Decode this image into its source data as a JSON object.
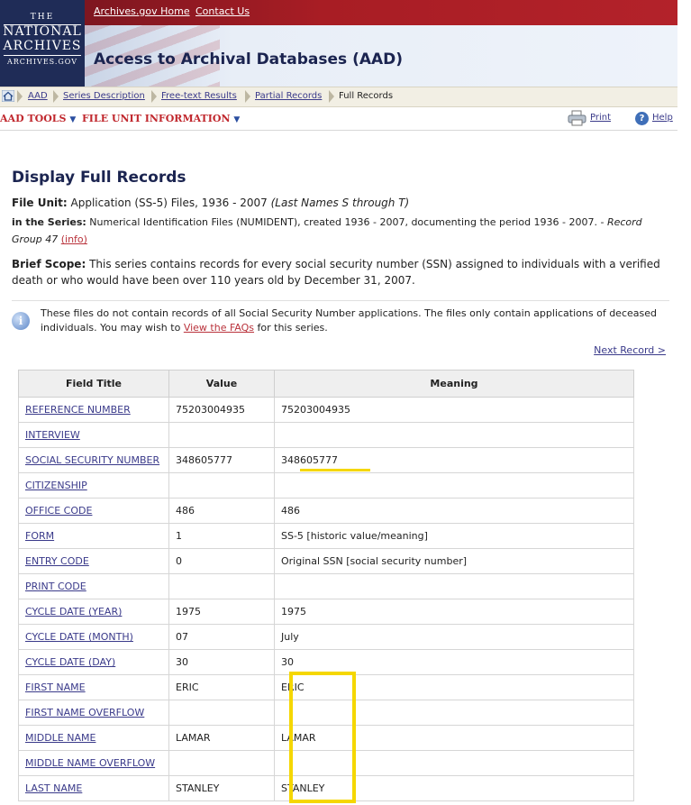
{
  "header": {
    "logo_line1": "THE",
    "logo_line2": "NATIONAL",
    "logo_line3": "ARCHIVES",
    "logo_line4": "ARCHIVES.GOV",
    "top_links": [
      "Archives.gov Home",
      "Contact Us"
    ],
    "site_title": "Access to Archival Databases (AAD)"
  },
  "breadcrumb": [
    "AAD",
    "Series Description",
    "Free-text Results",
    "Partial Records",
    "Full Records"
  ],
  "toolbar": {
    "aad_tools": "AAD TOOLS",
    "file_unit_info": "FILE UNIT INFORMATION",
    "print": "Print",
    "help": "Help"
  },
  "page": {
    "heading": "Display Full Records",
    "file_unit_label": "File Unit:",
    "file_unit_value": "Application (SS-5) Files, 1936 - 2007",
    "file_unit_italic": "(Last Names S through T)",
    "series_label": "in the Series:",
    "series_value": "Numerical Identification Files (NUMIDENT), created 1936 - 2007, documenting the period 1936 - 2007. -",
    "record_group_1": "Record",
    "record_group_2": "Group 47",
    "info_link": "(info)",
    "scope_label": "Brief Scope:",
    "scope_text": "This series contains records for every social security number (SSN) assigned to individuals with a verified death or who would have been over 110 years old by December 31, 2007.",
    "note_pre": "These files do not contain records of all Social Security Number applications. The files only contain applications of deceased individuals. You may wish to",
    "note_link": "View the FAQs",
    "note_post": "for this series.",
    "next_record": "Next Record >"
  },
  "table": {
    "headers": [
      "Field Title",
      "Value",
      "Meaning"
    ],
    "rows": [
      [
        "REFERENCE NUMBER",
        "75203004935",
        "75203004935"
      ],
      [
        "INTERVIEW",
        "",
        ""
      ],
      [
        "SOCIAL SECURITY NUMBER",
        "348605777",
        "348605777"
      ],
      [
        "CITIZENSHIP",
        "",
        ""
      ],
      [
        "OFFICE CODE",
        "486",
        "486"
      ],
      [
        "FORM",
        "1",
        "SS-5 [historic value/meaning]"
      ],
      [
        "ENTRY CODE",
        "0",
        "Original SSN [social security number]"
      ],
      [
        "PRINT CODE",
        "",
        ""
      ],
      [
        "CYCLE DATE (YEAR)",
        "1975",
        "1975"
      ],
      [
        "CYCLE DATE (MONTH)",
        "07",
        "July"
      ],
      [
        "CYCLE DATE (DAY)",
        "30",
        "30"
      ],
      [
        "FIRST NAME",
        "ERIC",
        "ERIC"
      ],
      [
        "FIRST NAME OVERFLOW",
        "",
        ""
      ],
      [
        "MIDDLE NAME",
        "LAMAR",
        "LAMAR"
      ],
      [
        "MIDDLE NAME OVERFLOW",
        "",
        ""
      ],
      [
        "LAST NAME",
        "STANLEY",
        "STANLEY"
      ]
    ]
  },
  "colors": {
    "highlight": "#f5d700",
    "brand_navy": "#1b2450",
    "header_red": "#a81d24",
    "tool_red": "#c0272d"
  }
}
